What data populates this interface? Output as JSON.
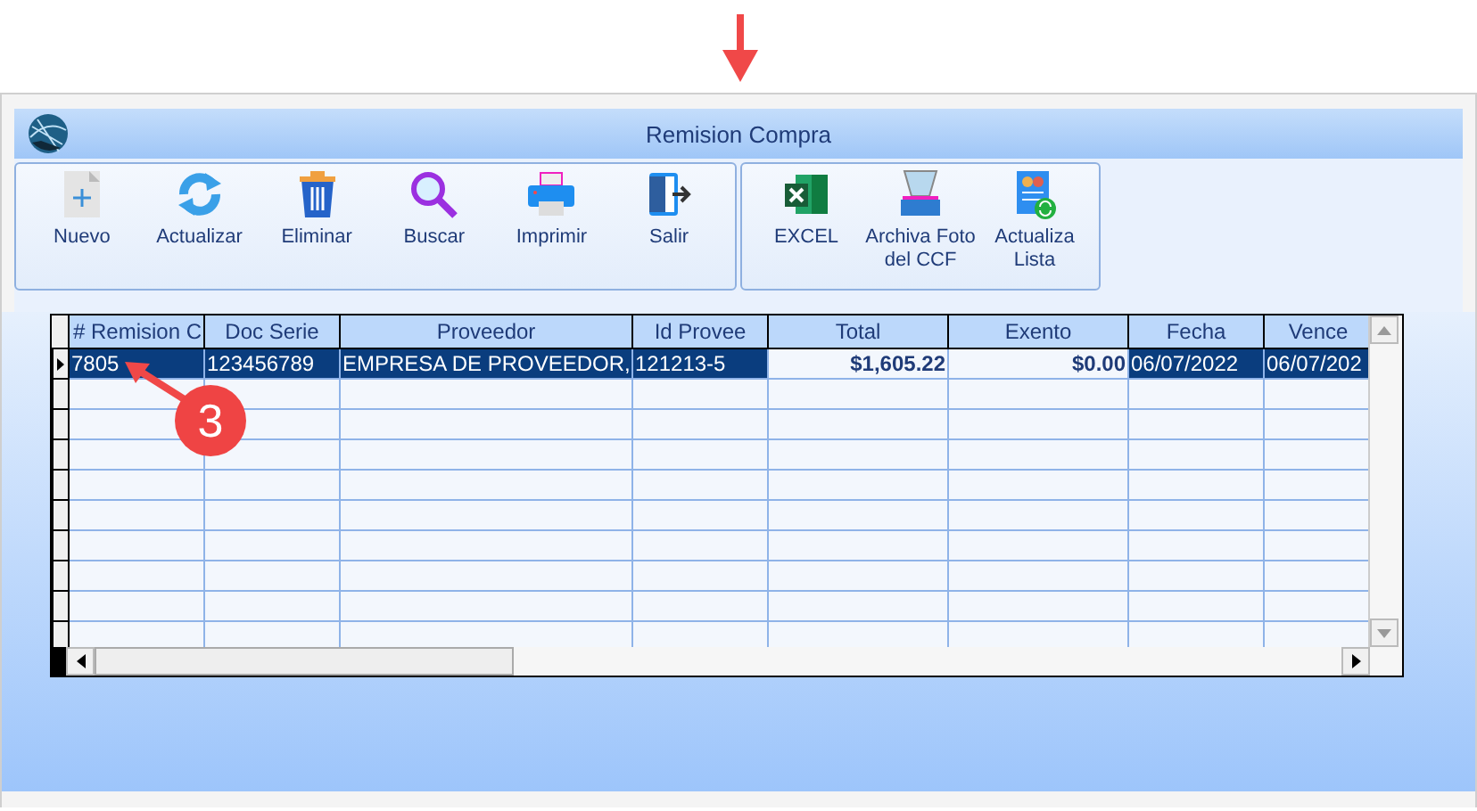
{
  "window": {
    "title": "Remision Compra"
  },
  "toolbar_groups": [
    {
      "buttons": [
        {
          "label": "Nuevo",
          "kind": "new"
        },
        {
          "label": "Actualizar",
          "kind": "refresh"
        },
        {
          "label": "Eliminar",
          "kind": "trash"
        },
        {
          "label": "Buscar",
          "kind": "search"
        },
        {
          "label": "Imprimir",
          "kind": "print"
        },
        {
          "label": "Salir",
          "kind": "exit"
        }
      ]
    },
    {
      "buttons": [
        {
          "label": "EXCEL",
          "kind": "excel"
        },
        {
          "label": "Archiva Foto del CCF",
          "kind": "scanner"
        },
        {
          "label": "Actualiza Lista",
          "kind": "list"
        }
      ]
    }
  ],
  "table": {
    "columns": [
      {
        "label": "# Remision C",
        "kind": "text"
      },
      {
        "label": "Doc Serie",
        "kind": "text"
      },
      {
        "label": "Proveedor",
        "kind": "text"
      },
      {
        "label": "Id Provee",
        "kind": "text"
      },
      {
        "label": "Total",
        "kind": "money"
      },
      {
        "label": "Exento",
        "kind": "money"
      },
      {
        "label": "Fecha",
        "kind": "text"
      },
      {
        "label": "Vence",
        "kind": "text"
      }
    ],
    "rows": [
      {
        "selected": true,
        "cells": [
          "7805",
          "123456789",
          "EMPRESA DE PROVEEDOR,",
          "121213-5",
          "$1,605.22",
          "$0.00",
          "06/07/2022",
          "06/07/202"
        ]
      }
    ]
  },
  "callout": {
    "label": "3"
  }
}
